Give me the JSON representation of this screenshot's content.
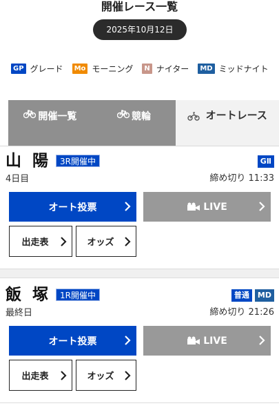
{
  "page": {
    "title": "開催レース一覧",
    "date": "2025年10月12日"
  },
  "legend": [
    {
      "badge": "GP",
      "label": "グレード",
      "color": "#0047c4"
    },
    {
      "badge": "Mo",
      "label": "モーニング",
      "color": "#f08a00"
    },
    {
      "badge": "N",
      "label": "ナイター",
      "color": "#c8968a"
    },
    {
      "badge": "MD",
      "label": "ミッドナイト",
      "color": "#1f5fa0"
    }
  ],
  "tabs": [
    {
      "label": "開催一覧",
      "icon": "bicycle-icon",
      "active": false
    },
    {
      "label": "競輪",
      "icon": "bicycle-icon",
      "active": false
    },
    {
      "label": "オートレース",
      "icon": "motorcycle-icon",
      "active": true
    }
  ],
  "venues": [
    {
      "name": "山陽",
      "status": "3R開催中",
      "day": "4日目",
      "grades": [
        {
          "label": "GⅡ",
          "color": "#0047c4"
        }
      ],
      "deadline": "締め切り 11:33",
      "vote_label": "オート投票",
      "live_label": "LIVE",
      "entries_label": "出走表",
      "odds_label": "オッズ"
    },
    {
      "name": "飯塚",
      "status": "1R開催中",
      "day": "最終日",
      "grades": [
        {
          "label": "普通",
          "color": "#0047c4"
        },
        {
          "label": "MD",
          "color": "#1f5fa0"
        }
      ],
      "deadline": "締め切り 21:26",
      "vote_label": "オート投票",
      "live_label": "LIVE",
      "entries_label": "出走表",
      "odds_label": "オッズ"
    }
  ],
  "colors": {
    "accent": "#0047c4",
    "live": "#999999",
    "tab_inactive": "#8f8f8f"
  }
}
